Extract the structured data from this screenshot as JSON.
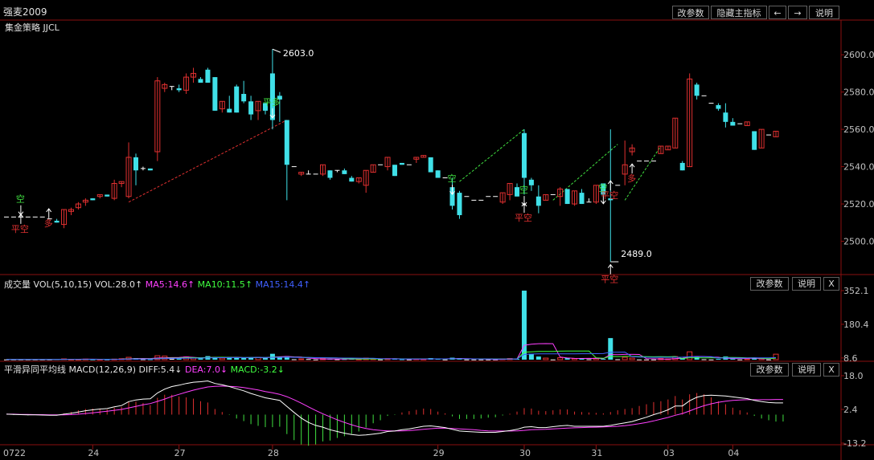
{
  "header": {
    "title": "强麦2009",
    "strategy": "集金策略 JJCL",
    "buttons": {
      "params": "改参数",
      "hide_indicator": "隐藏主指标",
      "prev": "←",
      "next": "→",
      "help": "说明"
    }
  },
  "volume_panel": {
    "name": "成交量",
    "formula": "VOL(5,10,15)",
    "vol": "VOL:28.0↑",
    "ma5": "MA5:14.6↑",
    "ma10": "MA10:11.5↑",
    "ma15": "MA15:14.4↑",
    "buttons": {
      "params": "改参数",
      "help": "说明",
      "close": "X"
    }
  },
  "macd_panel": {
    "name": "平滑异同平均线",
    "formula": "MACD(12,26,9)",
    "diff": "DIFF:5.4↓",
    "dea": "DEA:7.0↓",
    "macd": "MACD:-3.2↓",
    "buttons": {
      "params": "改参数",
      "help": "说明",
      "close": "X"
    }
  },
  "colors": {
    "up": "#e03030",
    "down": "#40e0e8",
    "ma5": "#ff40ff",
    "ma10": "#40ff40",
    "ma15": "#4060ff",
    "diff": "#ffffff",
    "dea": "#ff40ff"
  },
  "chart_data": {
    "type": "candlestick",
    "x_labels": [
      "0722",
      "24",
      "27",
      "28",
      "29",
      "30",
      "31",
      "03",
      "04"
    ],
    "price_ticks": [
      2500,
      2520,
      2540,
      2560,
      2580,
      2600
    ],
    "volume_ticks": [
      "352.1",
      "180.4",
      "8.6"
    ],
    "macd_ticks": [
      "18.0",
      "2.4",
      "-13.2"
    ],
    "price_ylim": [
      2483,
      2613
    ],
    "annotations": [
      {
        "text": "2603.0",
        "value": 2603.0,
        "kind": "high"
      },
      {
        "text": "2489.0",
        "value": 2489.0,
        "kind": "low"
      }
    ],
    "signals": [
      {
        "text": "空",
        "price": 2521,
        "kind": "short"
      },
      {
        "text": "平空",
        "price": 2505,
        "kind": "cover"
      },
      {
        "text": "多",
        "price": 2508,
        "kind": "long"
      },
      {
        "text": "平多",
        "price": 2573,
        "kind": "close-long"
      },
      {
        "text": "空",
        "price": 2532,
        "kind": "short"
      },
      {
        "text": "空",
        "price": 2526,
        "kind": "short"
      },
      {
        "text": "平空",
        "price": 2511,
        "kind": "cover"
      },
      {
        "text": "空",
        "price": 2527,
        "kind": "short"
      },
      {
        "text": "平空",
        "price": 2478,
        "kind": "cover"
      },
      {
        "text": "平空",
        "price": 2523,
        "kind": "cover"
      },
      {
        "text": "多",
        "price": 2532,
        "kind": "long"
      }
    ],
    "candles": [
      [
        2513,
        2513,
        2513,
        2513
      ],
      [
        2513,
        2513,
        2513,
        2513
      ],
      [
        2513,
        2513,
        2513,
        2513
      ],
      [
        2513,
        2513,
        2513,
        2513
      ],
      [
        2513,
        2513,
        2513,
        2513
      ],
      [
        2513,
        2513,
        2513,
        2513
      ],
      [
        2512,
        2512,
        2512,
        2512
      ],
      [
        2511,
        2512,
        2510,
        2510
      ],
      [
        2509,
        2517,
        2507,
        2517
      ],
      [
        2516,
        2518,
        2514,
        2517
      ],
      [
        2518,
        2521,
        2517,
        2520
      ],
      [
        2521,
        2523,
        2519,
        2522
      ],
      [
        2523,
        2523,
        2522,
        2522
      ],
      [
        2524,
        2525,
        2523,
        2525
      ],
      [
        2525,
        2525,
        2524,
        2524
      ],
      [
        2523,
        2533,
        2522,
        2531
      ],
      [
        2531,
        2532,
        2529,
        2532
      ],
      [
        2524,
        2553,
        2523,
        2545
      ],
      [
        2545,
        2547,
        2530,
        2538
      ],
      [
        2539,
        2540,
        2538,
        2539
      ],
      [
        2539,
        2539,
        2538,
        2538
      ],
      [
        2548,
        2588,
        2543,
        2586
      ],
      [
        2582,
        2585,
        2580,
        2584
      ],
      [
        2583,
        2583,
        2581,
        2583
      ],
      [
        2582,
        2584,
        2580,
        2581
      ],
      [
        2581,
        2590,
        2579,
        2588
      ],
      [
        2588,
        2593,
        2585,
        2590
      ],
      [
        2587,
        2588,
        2585,
        2585
      ],
      [
        2592,
        2593,
        2585,
        2585
      ],
      [
        2588,
        2588,
        2570,
        2570
      ],
      [
        2571,
        2575,
        2569,
        2575
      ],
      [
        2571,
        2578,
        2569,
        2569
      ],
      [
        2583,
        2584,
        2569,
        2569
      ],
      [
        2579,
        2586,
        2574,
        2575
      ],
      [
        2575,
        2578,
        2565,
        2568
      ],
      [
        2570,
        2575,
        2565,
        2575
      ],
      [
        2574,
        2574,
        2568,
        2570
      ],
      [
        2590,
        2603,
        2560,
        2565
      ],
      [
        2578,
        2580,
        2564,
        2576
      ],
      [
        2565,
        2565,
        2522,
        2541
      ],
      [
        2540,
        2540,
        2540,
        2540
      ],
      [
        2536,
        2537,
        2535,
        2537
      ],
      [
        2536,
        2538,
        2536,
        2536
      ],
      [
        2536,
        2536,
        2536,
        2536
      ],
      [
        2536,
        2541,
        2535,
        2541
      ],
      [
        2538,
        2538,
        2533,
        2534
      ],
      [
        2538,
        2538,
        2537,
        2538
      ],
      [
        2538,
        2539,
        2536,
        2536
      ],
      [
        2534,
        2535,
        2532,
        2532
      ],
      [
        2532,
        2534,
        2531,
        2534
      ],
      [
        2530,
        2538,
        2526,
        2538
      ],
      [
        2537,
        2541,
        2537,
        2541
      ],
      [
        2541,
        2541,
        2541,
        2541
      ],
      [
        2540,
        2545,
        2538,
        2545
      ],
      [
        2541,
        2541,
        2535,
        2535
      ],
      [
        2542,
        2542,
        2541,
        2541
      ],
      [
        2541,
        2541,
        2541,
        2541
      ],
      [
        2544,
        2545,
        2542,
        2545
      ],
      [
        2545,
        2546,
        2545,
        2546
      ],
      [
        2545,
        2545,
        2537,
        2537
      ],
      [
        2538,
        2538,
        2534,
        2534
      ],
      [
        2534,
        2534,
        2534,
        2534
      ],
      [
        2529,
        2534,
        2517,
        2519
      ],
      [
        2526,
        2527,
        2512,
        2514
      ],
      [
        2524,
        2524,
        2524,
        2524
      ],
      [
        2522,
        2522,
        2522,
        2522
      ],
      [
        2522,
        2522,
        2522,
        2522
      ],
      [
        2524,
        2524,
        2524,
        2524
      ],
      [
        2524,
        2524,
        2524,
        2524
      ],
      [
        2521,
        2526,
        2520,
        2526
      ],
      [
        2525,
        2531,
        2522,
        2531
      ],
      [
        2529,
        2531,
        2524,
        2524
      ],
      [
        2558,
        2560,
        2525,
        2534
      ],
      [
        2533,
        2534,
        2527,
        2530
      ],
      [
        2524,
        2530,
        2515,
        2519
      ],
      [
        2522,
        2525,
        2522,
        2525
      ],
      [
        2525,
        2525,
        2525,
        2525
      ],
      [
        2524,
        2529,
        2519,
        2528
      ],
      [
        2528,
        2528,
        2520,
        2520
      ],
      [
        2520,
        2527,
        2519,
        2527
      ],
      [
        2526,
        2528,
        2520,
        2520
      ],
      [
        2521,
        2523,
        2521,
        2521
      ],
      [
        2521,
        2530,
        2520,
        2530
      ],
      [
        2531,
        2531,
        2525,
        2525
      ],
      [
        2523,
        2560,
        2489,
        2522
      ],
      [
        2530,
        2530,
        2530,
        2530
      ],
      [
        2536,
        2554,
        2530,
        2541
      ],
      [
        2548,
        2552,
        2546,
        2550
      ],
      [
        2543,
        2543,
        2543,
        2543
      ],
      [
        2543,
        2543,
        2543,
        2543
      ],
      [
        2543,
        2543,
        2543,
        2543
      ],
      [
        2547,
        2551,
        2547,
        2551
      ],
      [
        2549,
        2551,
        2549,
        2551
      ],
      [
        2550,
        2566,
        2550,
        2566
      ],
      [
        2542,
        2543,
        2538,
        2538
      ],
      [
        2540,
        2590,
        2540,
        2587
      ],
      [
        2584,
        2585,
        2576,
        2578
      ],
      [
        2578,
        2578,
        2578,
        2578
      ],
      [
        2574,
        2574,
        2574,
        2574
      ],
      [
        2573,
        2574,
        2570,
        2571
      ],
      [
        2569,
        2574,
        2561,
        2564
      ],
      [
        2564,
        2566,
        2562,
        2562
      ],
      [
        2563,
        2563,
        2563,
        2563
      ],
      [
        2562,
        2564,
        2562,
        2564
      ],
      [
        2559,
        2559,
        2549,
        2549
      ],
      [
        2550,
        2560,
        2550,
        2560
      ],
      [
        2557,
        2557,
        2557,
        2557
      ],
      [
        2556,
        2559,
        2556,
        2559
      ]
    ],
    "volume": [
      1,
      1,
      1,
      1,
      1,
      1,
      1,
      2,
      4,
      2,
      2,
      3,
      1,
      2,
      1,
      3,
      5,
      12,
      8,
      2,
      2,
      20,
      18,
      12,
      6,
      14,
      10,
      6,
      18,
      12,
      8,
      14,
      10,
      8,
      10,
      12,
      8,
      30,
      14,
      18,
      2,
      4,
      3,
      1,
      6,
      4,
      2,
      3,
      4,
      3,
      8,
      6,
      1,
      5,
      6,
      2,
      1,
      4,
      3,
      8,
      4,
      1,
      10,
      8,
      1,
      1,
      1,
      1,
      1,
      4,
      6,
      4,
      352,
      30,
      16,
      8,
      1,
      10,
      8,
      6,
      6,
      2,
      8,
      4,
      110,
      2,
      12,
      8,
      1,
      1,
      1,
      6,
      4,
      16,
      8,
      40,
      14,
      2,
      1,
      4,
      16,
      6,
      1,
      4,
      10,
      6,
      1,
      28
    ],
    "diff": [
      0.2,
      0.1,
      0,
      -0.1,
      -0.1,
      -0.2,
      -0.3,
      -0.3,
      0.2,
      0.6,
      1.2,
      1.8,
      2.2,
      2.6,
      2.8,
      3.6,
      4.2,
      6,
      6.8,
      7.2,
      7.3,
      10,
      11.8,
      13,
      13.6,
      14.4,
      15,
      15.2,
      15.6,
      14.4,
      13.8,
      13,
      12,
      11,
      9.8,
      8.8,
      7.8,
      7.2,
      6.6,
      3.8,
      1,
      -1.6,
      -3.6,
      -5,
      -5.8,
      -7,
      -7.8,
      -8.6,
      -9.2,
      -9.6,
      -9.4,
      -9,
      -8.6,
      -7.8,
      -7.6,
      -7,
      -6.6,
      -6,
      -5.4,
      -5.2,
      -5.6,
      -6,
      -6.8,
      -7.6,
      -7.8,
      -8,
      -8.2,
      -8.2,
      -8.2,
      -7.8,
      -7.4,
      -6.8,
      -5.8,
      -5.6,
      -6,
      -6,
      -5.6,
      -5.2,
      -5,
      -5.4,
      -5.4,
      -5.4,
      -5.4,
      -5.4,
      -5,
      -4.4,
      -3.8,
      -3.2,
      -2.2,
      -1.2,
      0,
      1,
      2.2,
      4,
      4,
      6.4,
      8,
      8.8,
      9,
      8.8,
      8.6,
      8.2,
      7.8,
      7.4,
      6.6,
      6,
      5.6,
      5.4,
      5.4
    ],
    "dea": [
      0.2,
      0.2,
      0.1,
      0.1,
      0,
      0,
      -0.1,
      -0.1,
      -0.1,
      0,
      0.2,
      0.5,
      0.8,
      1.2,
      1.6,
      2,
      2.4,
      3.1,
      3.8,
      4.5,
      5.1,
      6.1,
      7.2,
      8.4,
      9.4,
      10.4,
      11.3,
      12.1,
      12.8,
      13.1,
      13.2,
      13.1,
      12.9,
      12.5,
      12,
      11.4,
      10.7,
      10.1,
      9.4,
      8.3,
      6.9,
      5.3,
      3.6,
      1.9,
      0.4,
      -1,
      -2.4,
      -3.6,
      -4.7,
      -5.7,
      -6.4,
      -7,
      -7.3,
      -7.5,
      -7.5,
      -7.5,
      -7.4,
      -7.1,
      -6.8,
      -6.5,
      -6.3,
      -6.3,
      -6.4,
      -6.6,
      -6.8,
      -7,
      -7.3,
      -7.5,
      -7.6,
      -7.6,
      -7.6,
      -7.5,
      -7.3,
      -7,
      -6.9,
      -6.8,
      -6.6,
      -6.4,
      -6.2,
      -6.1,
      -6,
      -5.9,
      -5.8,
      -5.7,
      -5.6,
      -5.4,
      -5.1,
      -4.7,
      -4.2,
      -3.6,
      -2.9,
      -2.1,
      -1.3,
      -0.3,
      0.5,
      1.7,
      3,
      4.1,
      5,
      5.7,
      6.2,
      6.6,
      6.8,
      6.9,
      6.9,
      6.9,
      6.9,
      7,
      7
    ]
  }
}
